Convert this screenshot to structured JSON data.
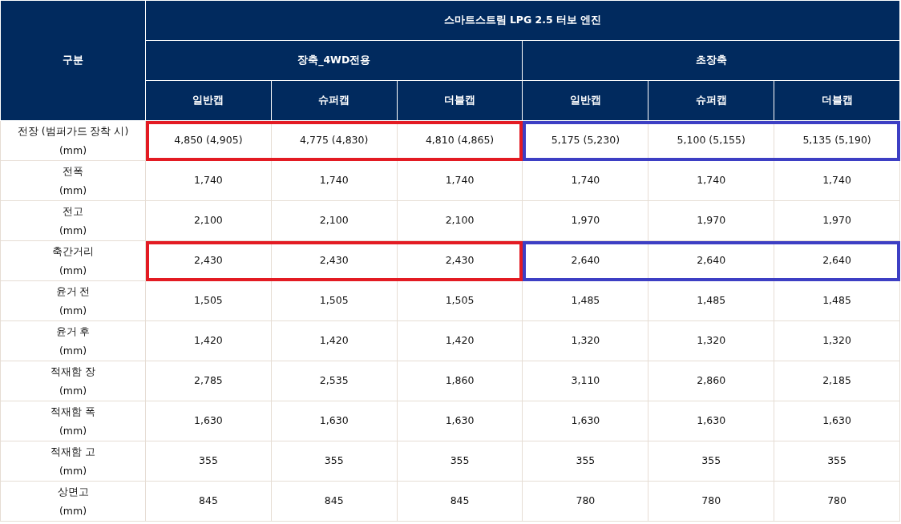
{
  "table": {
    "corner": "구분",
    "engine": "스마트스트림 LPG 2.5 터보 엔진",
    "groups": [
      {
        "name": "장축_4WD전용",
        "color": "#e31b23",
        "columns": [
          "일반캡",
          "슈퍼캡",
          "더블캡"
        ]
      },
      {
        "name": "초장축",
        "color": "#3d3fc4",
        "columns": [
          "일반캡",
          "슈퍼캡",
          "더블캡"
        ]
      }
    ],
    "rows": [
      {
        "label": "전장 (범퍼가드 장착 시)",
        "unit": "(mm)",
        "highlighted": true,
        "values": [
          "4,850 (4,905)",
          "4,775 (4,830)",
          "4,810 (4,865)",
          "5,175 (5,230)",
          "5,100 (5,155)",
          "5,135 (5,190)"
        ]
      },
      {
        "label": "전폭",
        "unit": "(mm)",
        "highlighted": false,
        "values": [
          "1,740",
          "1,740",
          "1,740",
          "1,740",
          "1,740",
          "1,740"
        ]
      },
      {
        "label": "전고",
        "unit": "(mm)",
        "highlighted": false,
        "values": [
          "2,100",
          "2,100",
          "2,100",
          "1,970",
          "1,970",
          "1,970"
        ]
      },
      {
        "label": "축간거리",
        "unit": "(mm)",
        "highlighted": true,
        "values": [
          "2,430",
          "2,430",
          "2,430",
          "2,640",
          "2,640",
          "2,640"
        ]
      },
      {
        "label": "윤거 전",
        "unit": "(mm)",
        "highlighted": false,
        "values": [
          "1,505",
          "1,505",
          "1,505",
          "1,485",
          "1,485",
          "1,485"
        ]
      },
      {
        "label": "윤거 후",
        "unit": "(mm)",
        "highlighted": false,
        "values": [
          "1,420",
          "1,420",
          "1,420",
          "1,320",
          "1,320",
          "1,320"
        ]
      },
      {
        "label": "적재함 장",
        "unit": "(mm)",
        "highlighted": false,
        "values": [
          "2,785",
          "2,535",
          "1,860",
          "3,110",
          "2,860",
          "2,185"
        ]
      },
      {
        "label": "적재함 폭",
        "unit": "(mm)",
        "highlighted": false,
        "values": [
          "1,630",
          "1,630",
          "1,630",
          "1,630",
          "1,630",
          "1,630"
        ]
      },
      {
        "label": "적재함 고",
        "unit": "(mm)",
        "highlighted": false,
        "values": [
          "355",
          "355",
          "355",
          "355",
          "355",
          "355"
        ]
      },
      {
        "label": "상면고",
        "unit": "(mm)",
        "highlighted": false,
        "values": [
          "845",
          "845",
          "845",
          "780",
          "780",
          "780"
        ]
      }
    ]
  }
}
